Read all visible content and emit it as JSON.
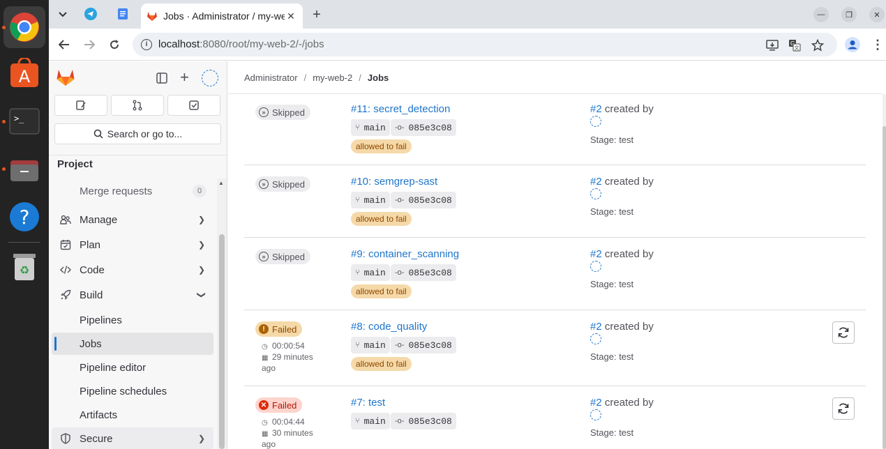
{
  "browser": {
    "tab_title": "Jobs · Administrator / my-web-2 · GitLab",
    "url_host": "localhost",
    "url_rest": ":8080/root/my-web-2/-/jobs"
  },
  "sidebar": {
    "search_label": "Search or go to...",
    "section_title": "Project",
    "items": [
      {
        "label": "Merge requests",
        "count": "0"
      },
      {
        "label": "Manage"
      },
      {
        "label": "Plan"
      },
      {
        "label": "Code"
      },
      {
        "label": "Build"
      },
      {
        "label": "Pipelines"
      },
      {
        "label": "Jobs"
      },
      {
        "label": "Pipeline editor"
      },
      {
        "label": "Pipeline schedules"
      },
      {
        "label": "Artifacts"
      },
      {
        "label": "Secure"
      }
    ]
  },
  "breadcrumb": [
    "Administrator",
    "my-web-2",
    "Jobs"
  ],
  "jobs": [
    {
      "status": "Skipped",
      "name": "#11: secret_detection",
      "ref": "main",
      "commit": "085e3c08",
      "tag": "allowed to fail",
      "pipeline": "#2",
      "created_by": "created by",
      "stage": "Stage: test"
    },
    {
      "status": "Skipped",
      "name": "#10: semgrep-sast",
      "ref": "main",
      "commit": "085e3c08",
      "tag": "allowed to fail",
      "pipeline": "#2",
      "created_by": "created by",
      "stage": "Stage: test"
    },
    {
      "status": "Skipped",
      "name": "#9: container_scanning",
      "ref": "main",
      "commit": "085e3c08",
      "tag": "allowed to fail",
      "pipeline": "#2",
      "created_by": "created by",
      "stage": "Stage: test"
    },
    {
      "status": "Failed",
      "duration": "00:00:54",
      "finished_1": "29 minutes",
      "finished_2": "ago",
      "name": "#8: code_quality",
      "ref": "main",
      "commit": "085e3c08",
      "tag": "allowed to fail",
      "pipeline": "#2",
      "created_by": "created by",
      "stage": "Stage: test"
    },
    {
      "status": "Failed",
      "duration": "00:04:44",
      "finished_1": "30 minutes",
      "finished_2": "ago",
      "name": "#7: test",
      "ref": "main",
      "commit": "085e3c08",
      "pipeline": "#2",
      "created_by": "created by",
      "stage": "Stage: test"
    }
  ]
}
